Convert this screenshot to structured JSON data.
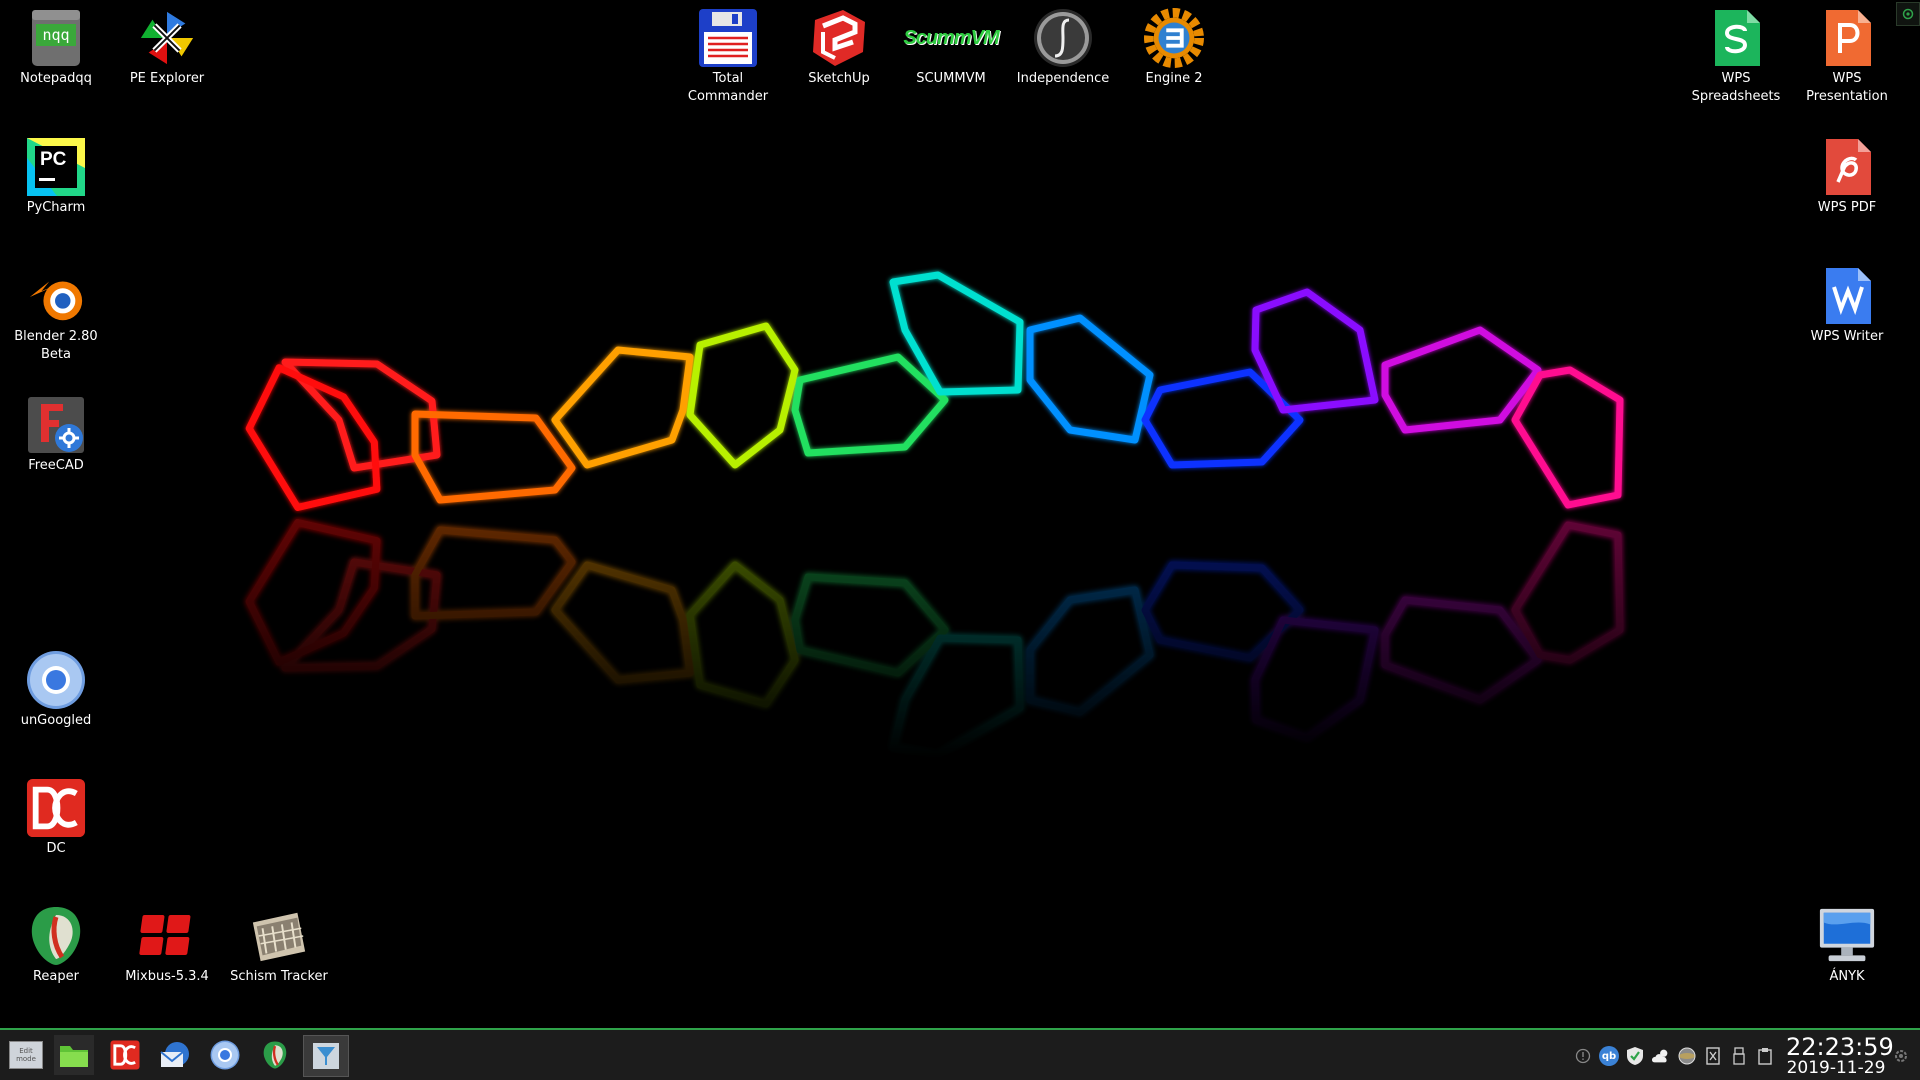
{
  "desktop": {
    "icons": [
      {
        "label": "Notepadqq",
        "icon": "notepadqq-icon"
      },
      {
        "label": "PE Explorer",
        "icon": "pe-explorer-icon"
      },
      {
        "label": "PyCharm",
        "icon": "pycharm-icon"
      },
      {
        "label": "Blender 2.80\nBeta",
        "icon": "blender-icon"
      },
      {
        "label": "FreeCAD",
        "icon": "freecad-icon"
      },
      {
        "label": "unGoogled",
        "icon": "ungoogled-chromium-icon"
      },
      {
        "label": "DC",
        "icon": "dc-icon"
      },
      {
        "label": "Reaper",
        "icon": "reaper-icon"
      },
      {
        "label": "Mixbus-5.3.4",
        "icon": "mixbus-icon"
      },
      {
        "label": "Schism Tracker",
        "icon": "schism-tracker-icon"
      },
      {
        "label": "Total\nCommander",
        "icon": "total-commander-icon"
      },
      {
        "label": "SketchUp",
        "icon": "sketchup-icon"
      },
      {
        "label": "SCUMMVM",
        "icon": "scummvm-icon"
      },
      {
        "label": "Independence",
        "icon": "independence-icon"
      },
      {
        "label": "Engine 2",
        "icon": "engine2-icon"
      },
      {
        "label": "WPS\nSpreadsheets",
        "icon": "wps-spreadsheets-icon"
      },
      {
        "label": "WPS\nPresentation",
        "icon": "wps-presentation-icon"
      },
      {
        "label": "WPS PDF",
        "icon": "wps-pdf-icon"
      },
      {
        "label": "WPS Writer",
        "icon": "wps-writer-icon"
      },
      {
        "label": "ÁNYK",
        "icon": "anyk-monitor-icon"
      }
    ],
    "scummvm_logo_text": "ScummVM",
    "pycharm_logo_text": "PC",
    "notepadqq_logo_text": "nqq"
  },
  "taskbar": {
    "menu_button_text": "Edit mode",
    "launchers": [
      "start-menu-icon",
      "file-manager-icon",
      "dc-icon",
      "mail-icon",
      "chromium-icon",
      "reaper-icon",
      "terminal-icon"
    ],
    "tray_icons": [
      "info-icon",
      "qbittorrent-icon",
      "shield-icon",
      "weather-icon",
      "network-icon",
      "keyboard-icon",
      "usb-icon",
      "clipboard-icon"
    ],
    "qb_text": "qb",
    "clock": {
      "time": "22:23:59",
      "date": "2019-11-29"
    }
  },
  "colors": {
    "taskbar_bg": "#1c1c1c",
    "taskbar_accent": "#2fa34a",
    "desktop_bg": "#000000"
  }
}
